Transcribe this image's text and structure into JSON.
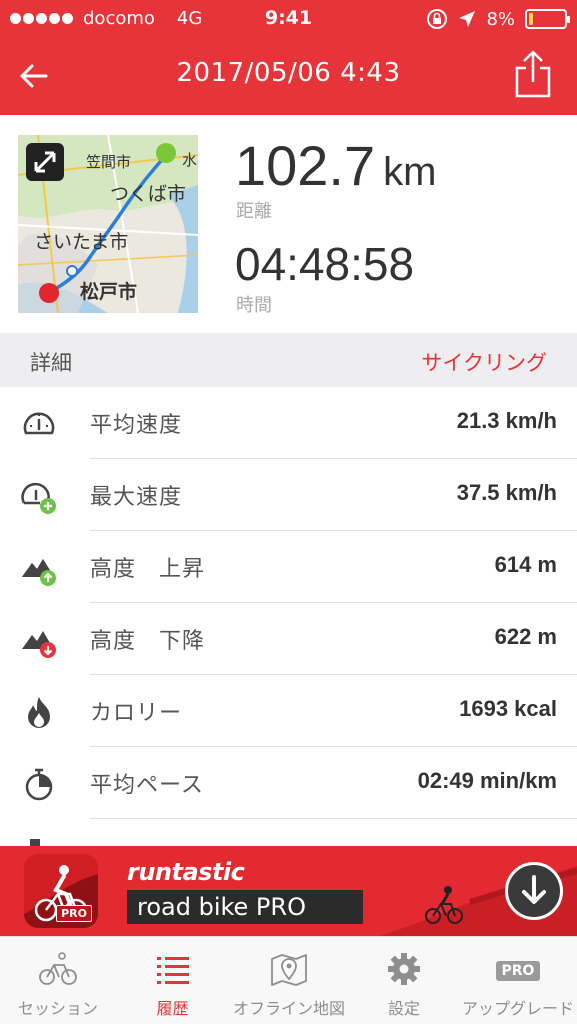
{
  "status_bar": {
    "carrier": "docomo",
    "network": "4G",
    "time": "9:41",
    "battery": "8%"
  },
  "header": {
    "title": "2017/05/06 4:43",
    "back_icon": "arrow-left-icon",
    "share_icon": "share-icon"
  },
  "summary": {
    "map_labels": [
      "笠間市",
      "水",
      "つくば市",
      "さいたま市",
      "松戸市"
    ],
    "distance_value": "102.7",
    "distance_unit": "km",
    "distance_label": "距離",
    "duration_value": "04:48:58",
    "duration_label": "時間"
  },
  "details": {
    "title": "詳細",
    "activity_type": "サイクリング",
    "rows": [
      {
        "label": "平均速度",
        "value": "21.3 km/h",
        "icon": "speedometer-icon"
      },
      {
        "label": "最大速度",
        "value": "37.5 km/h",
        "icon": "speedometer-plus-icon"
      },
      {
        "label": "高度　上昇",
        "value": "614 m",
        "icon": "elevation-up-icon"
      },
      {
        "label": "高度　下降",
        "value": "622 m",
        "icon": "elevation-down-icon"
      },
      {
        "label": "カロリー",
        "value": "1693 kcal",
        "icon": "flame-icon"
      },
      {
        "label": "平均ペース",
        "value": "02:49 min/km",
        "icon": "stopwatch-icon"
      }
    ]
  },
  "banner": {
    "brand": "runtastic",
    "product": "road bike PRO",
    "pro_badge": "PRO"
  },
  "tabs": [
    {
      "label": "セッション",
      "icon": "cycling-icon",
      "active": false
    },
    {
      "label": "履歴",
      "icon": "list-icon",
      "active": true
    },
    {
      "label": "オフライン地図",
      "icon": "map-pin-icon",
      "active": false
    },
    {
      "label": "設定",
      "icon": "gear-icon",
      "active": false
    },
    {
      "label": "アップグレード",
      "icon": "pro-icon",
      "active": false,
      "badge": "PRO"
    }
  ],
  "colors": {
    "accent": "#e7343a",
    "section_bg": "#eeeef0",
    "green_badge": "#6cc24a",
    "red_badge": "#e7343a"
  }
}
